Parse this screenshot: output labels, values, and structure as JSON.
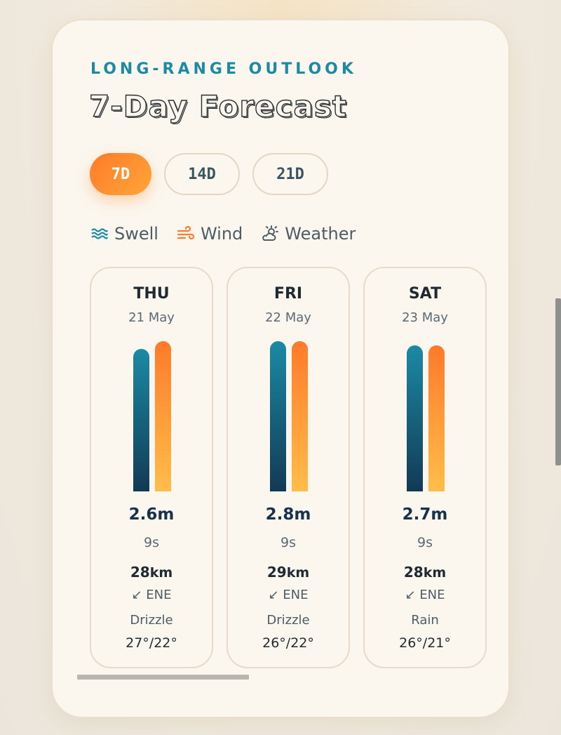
{
  "header": {
    "eyebrow": "LONG-RANGE OUTLOOK",
    "title": "7-Day Forecast"
  },
  "tabs": [
    {
      "label": "7D",
      "active": true
    },
    {
      "label": "14D",
      "active": false
    },
    {
      "label": "21D",
      "active": false
    }
  ],
  "legend": [
    {
      "label": "Swell",
      "icon": "waves-icon",
      "color": "#1b8aa5"
    },
    {
      "label": "Wind",
      "icon": "wind-icon",
      "color": "#ff7a2a"
    },
    {
      "label": "Weather",
      "icon": "sun-cloud-icon",
      "color": "#4d5c66"
    }
  ],
  "days": [
    {
      "day": "THU",
      "date": "21 May",
      "swell_height": "2.6m",
      "period": "9s",
      "wind_speed": "28",
      "wind_unit": "km",
      "wind_dir": "ENE",
      "condition": "Drizzle",
      "temps": "27°/22°",
      "swell_level": 0.95,
      "wind_level": 1.0
    },
    {
      "day": "FRI",
      "date": "22 May",
      "swell_height": "2.8m",
      "period": "9s",
      "wind_speed": "29",
      "wind_unit": "km",
      "wind_dir": "ENE",
      "condition": "Drizzle",
      "temps": "26°/22°",
      "swell_level": 1.0,
      "wind_level": 1.0
    },
    {
      "day": "SAT",
      "date": "23 May",
      "swell_height": "2.7m",
      "period": "9s",
      "wind_speed": "28",
      "wind_unit": "km",
      "wind_dir": "ENE",
      "condition": "Rain",
      "temps": "26°/21°",
      "swell_level": 0.97,
      "wind_level": 0.97
    }
  ],
  "colors": {
    "accent_teal": "#1b8aa5",
    "accent_orange": "#ff7a2a",
    "card_bg": "#fbf7ee"
  }
}
